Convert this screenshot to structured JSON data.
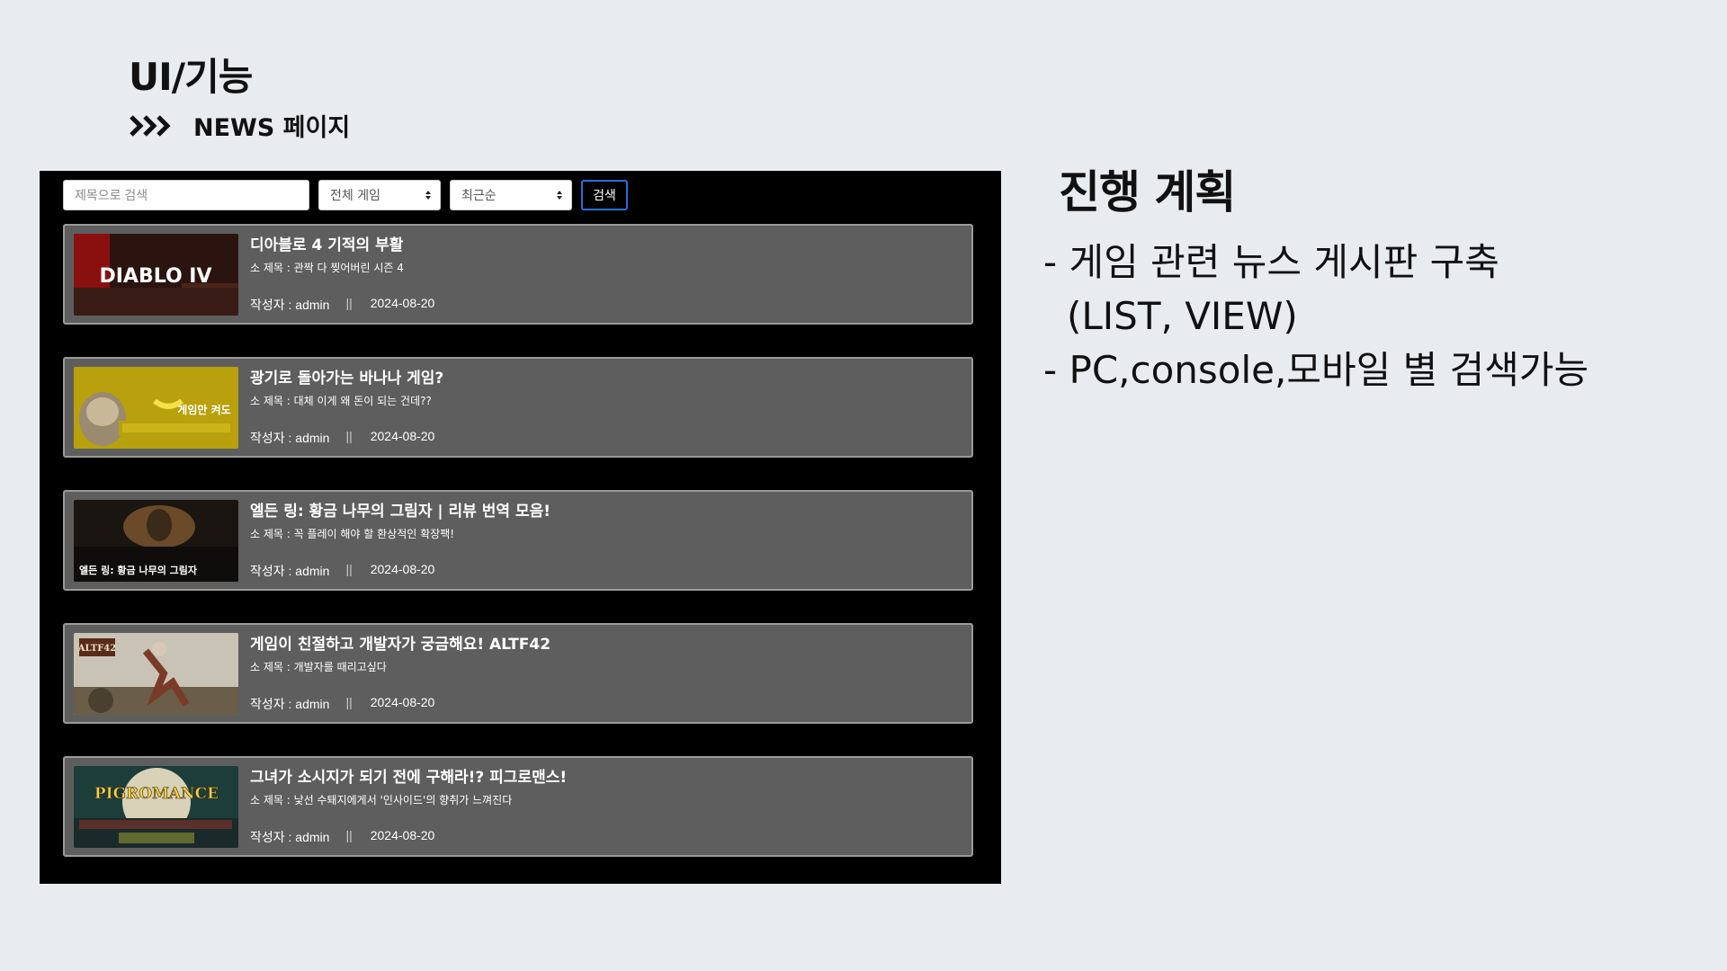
{
  "slide": {
    "title": "UI/기능",
    "subtitle": "NEWS 페이지"
  },
  "toolbar": {
    "search_placeholder": "제목으로 검색",
    "game_filter": "전체 게임",
    "sort_order": "최근순",
    "search_button": "검색"
  },
  "news": [
    {
      "title": "디아블로 4 기적의 부활",
      "subtitle": "소 제목 : 관짝 다 찢어버린 시즌 4",
      "author": "작성자 : admin",
      "separator": "||",
      "date": "2024-08-20",
      "thumb_text": "DIABLO IV"
    },
    {
      "title": "광기로 돌아가는 바나나 게임?",
      "subtitle": "소 제목 : 대체 이게 왜 돈이 되는 건데??",
      "author": "작성자 : admin",
      "separator": "||",
      "date": "2024-08-20",
      "thumb_text": "게임만 켜도"
    },
    {
      "title": "엘든 링: 황금 나무의 그림자 | 리뷰 번역 모음!",
      "subtitle": "소 제목 : 꼭 플레이 해야 할 환상적인 확장팩!",
      "author": "작성자 : admin",
      "separator": "||",
      "date": "2024-08-20",
      "thumb_text": "엘든 링: 황금 나무의 그림자"
    },
    {
      "title": "게임이 친절하고 개발자가 궁금해요! ALTF42",
      "subtitle": "소 제목 : 개발자를 때리고싶다",
      "author": "작성자 : admin",
      "separator": "||",
      "date": "2024-08-20",
      "thumb_text": "ALTF42"
    },
    {
      "title": "그녀가 소시지가 되기 전에 구해라!? 피그로맨스!",
      "subtitle": "소 제목 : 낯선 수퇘지에게서 '인사이드'의 향취가 느껴진다",
      "author": "작성자 : admin",
      "separator": "||",
      "date": "2024-08-20",
      "thumb_text": "PIGROMANCE"
    }
  ],
  "plan": {
    "title": "진행 계획",
    "items": [
      "- 게임 관련 뉴스 게시판 구축",
      "(LIST, VIEW)",
      "- PC,console,모바일 별 검색가능"
    ]
  },
  "colors": {
    "background": "#e9ecef",
    "panel": "#000000",
    "card": "#5e5e5e",
    "card_border": "#9a9a9a",
    "button_border": "#2d6fd6"
  }
}
